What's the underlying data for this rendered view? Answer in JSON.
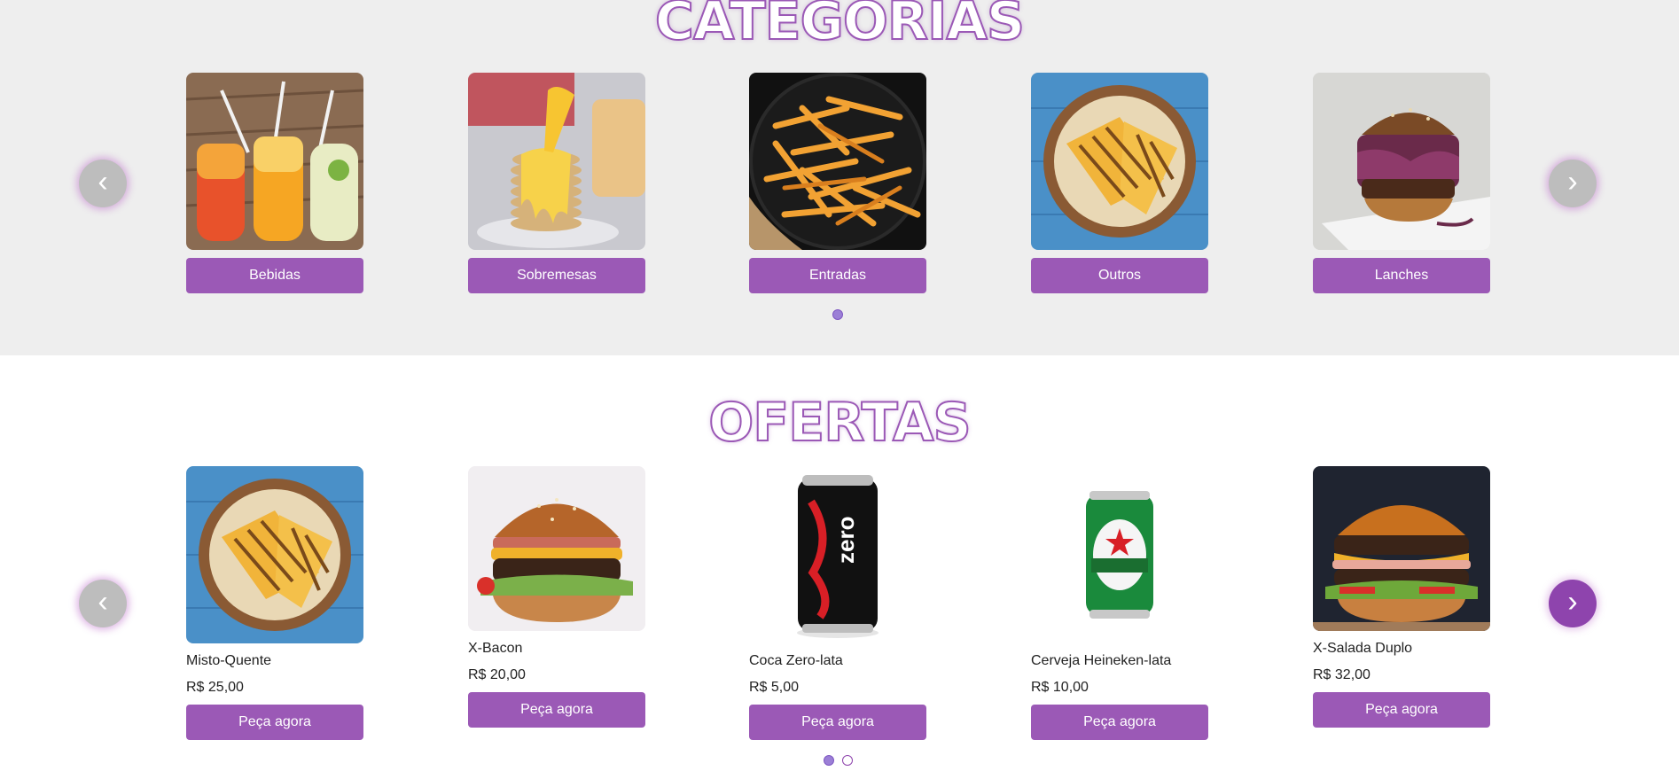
{
  "categories": {
    "title": "CATEGORIAS",
    "prev_icon": "‹",
    "next_icon": "›",
    "items": [
      {
        "label": "Bebidas"
      },
      {
        "label": "Sobremesas"
      },
      {
        "label": "Entradas"
      },
      {
        "label": "Outros"
      },
      {
        "label": "Lanches"
      }
    ]
  },
  "offers": {
    "title": "OFERTAS",
    "prev_icon": "‹",
    "next_icon": "›",
    "button_label": "Peça agora",
    "items": [
      {
        "name": "Misto-Quente",
        "price": "R$ 25,00"
      },
      {
        "name": "X-Bacon",
        "price": "R$ 20,00"
      },
      {
        "name": "Coca Zero-lata",
        "price": "R$ 5,00"
      },
      {
        "name": "Cerveja Heineken-lata",
        "price": "R$ 10,00"
      },
      {
        "name": "X-Salada Duplo",
        "price": "R$ 32,00"
      }
    ]
  },
  "colors": {
    "accent": "#9b59b6",
    "accent_dark": "#8e44ad",
    "section_bg": "#eeeeee"
  }
}
